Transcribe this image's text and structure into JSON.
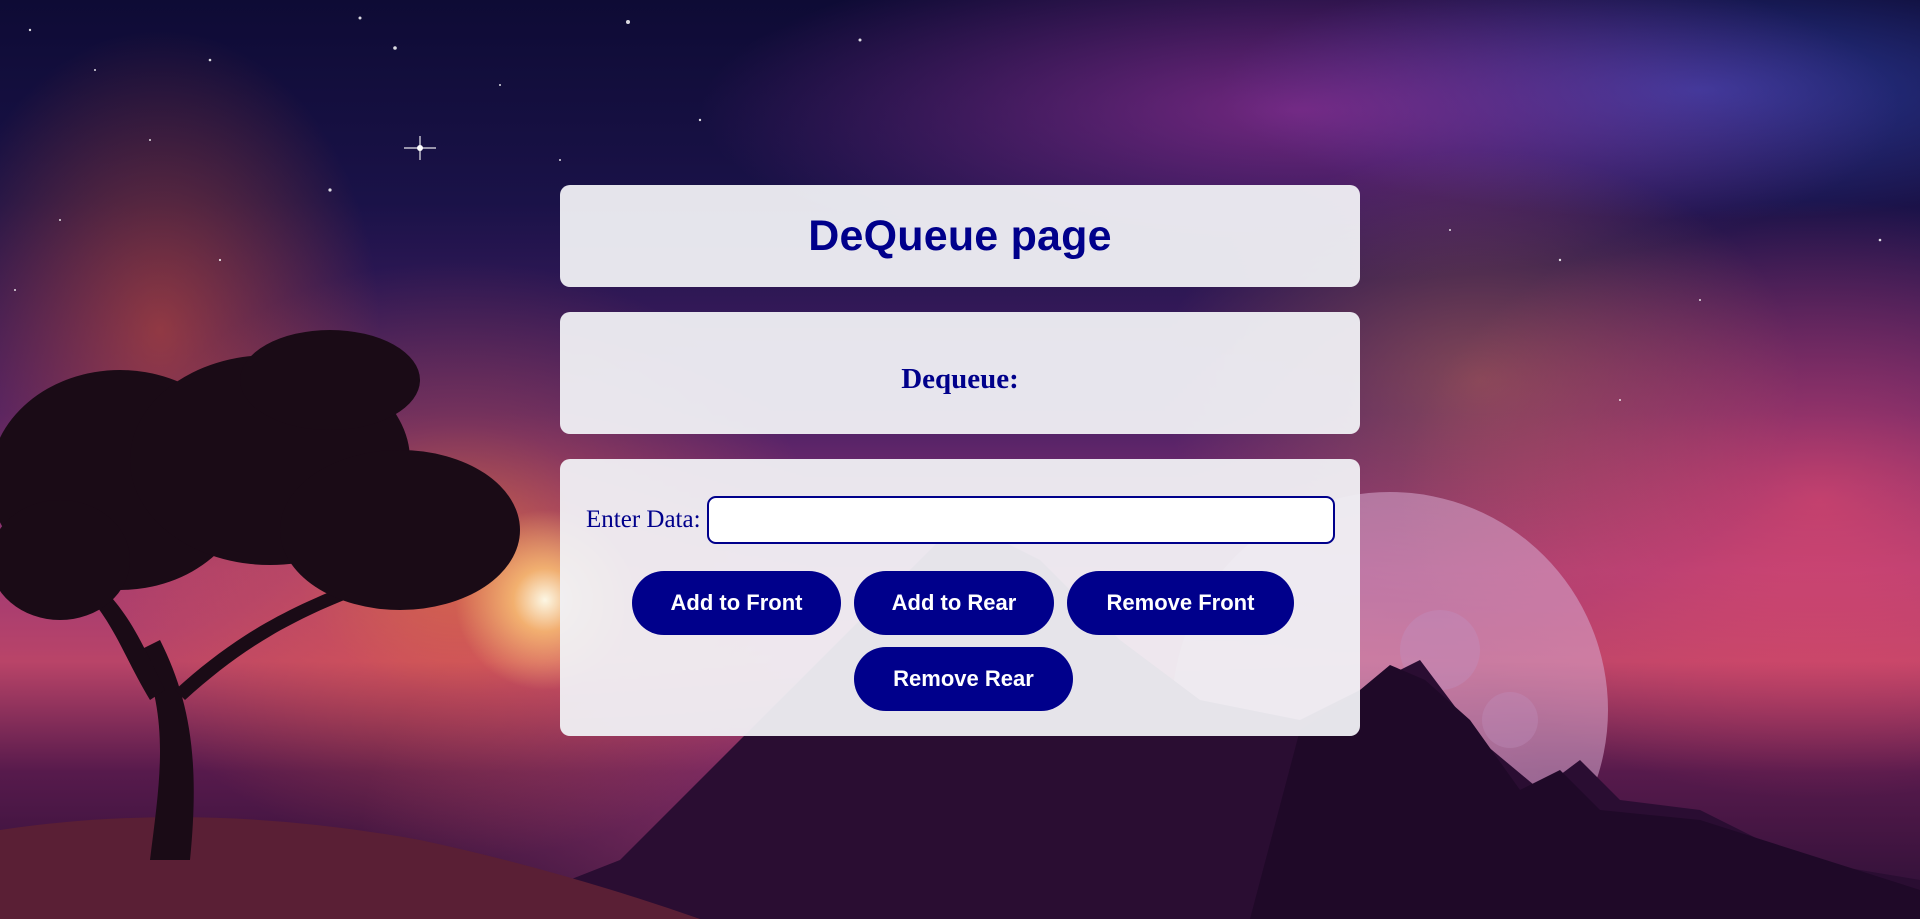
{
  "header": {
    "title": "DeQueue page"
  },
  "display": {
    "label": "Dequeue:"
  },
  "controls": {
    "input_label": "Enter Data:",
    "input_value": "",
    "input_placeholder": "",
    "buttons": {
      "add_front": "Add to Front",
      "add_rear": "Add to Rear",
      "remove_front": "Remove Front",
      "remove_rear": "Remove Rear"
    }
  },
  "colors": {
    "accent": "#00008b",
    "panel": "#f0f0f4",
    "button_text": "#ffffff"
  }
}
